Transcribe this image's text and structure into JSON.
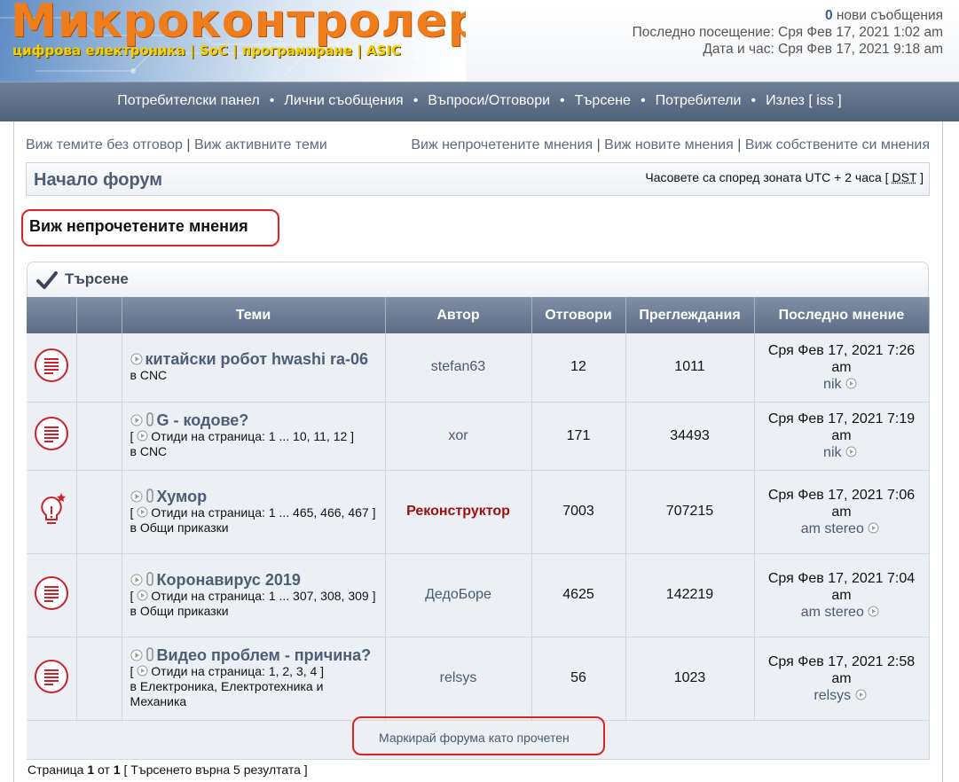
{
  "header": {
    "logo_title": "Микроконтролери",
    "logo_subtitle": "цифрова електроника | SoC | програмиране | ASIC",
    "new_messages_count": "0",
    "new_messages_label": " нови съобщения",
    "last_visit": "Последно посещение: Сря Фев 17, 2021 1:02 am",
    "current_time": "Дата и час: Сря Фев 17, 2021 9:18 am"
  },
  "navbar": {
    "items": [
      "Потребителски панел",
      "Лични съобщения",
      "Въпроси/Отговори",
      "Търсене",
      "Потребители",
      "Излез [ iss ]"
    ]
  },
  "quick_links": {
    "left": [
      "Виж темите без отговор",
      "Виж активните теми"
    ],
    "right": [
      "Виж непрочетените мнения",
      "Виж новите мнения",
      "Виж собствените си мнения"
    ]
  },
  "breadcrumb": {
    "title": "Начало форум"
  },
  "timezone": {
    "prefix": "Часовете са според зоната UTC + 2 часа [ ",
    "dst": "DST",
    "suffix": " ]"
  },
  "page_heading": "Виж непрочетените мнения",
  "panel": {
    "title": "Търсене"
  },
  "table": {
    "headers": {
      "topics": "Теми",
      "author": "Автор",
      "replies": "Отговори",
      "views": "Преглеждания",
      "last_post": "Последно мнение"
    },
    "rows": [
      {
        "title": "китайски робот hwashi ra-06",
        "pages_prefix": "",
        "pages": "",
        "forum_prefix": "в ",
        "forum": "CNC",
        "author": "stefan63",
        "replies": "12",
        "views": "1011",
        "last_date": "Сря Фев 17, 2021 7:26",
        "last_ampm": "am",
        "last_by": "nik"
      },
      {
        "title": "G - кодове?",
        "pages_prefix": "Отиди на страница: ",
        "pages": "1 ... 10, 11, 12",
        "forum_prefix": "в ",
        "forum": "CNC",
        "author": "xor",
        "replies": "171",
        "views": "34493",
        "last_date": "Сря Фев 17, 2021 7:19",
        "last_ampm": "am",
        "last_by": "nik"
      },
      {
        "title": "Хумор",
        "pages_prefix": "Отиди на страница: ",
        "pages": "1 ... 465, 466, 467",
        "forum_prefix": "в ",
        "forum": "Общи приказки",
        "author": "Реконструктор",
        "replies": "7003",
        "views": "707215",
        "last_date": "Сря Фев 17, 2021 7:06",
        "last_ampm": "am",
        "last_by": "am stereo"
      },
      {
        "title": "Коронавирус 2019",
        "pages_prefix": "Отиди на страница: ",
        "pages": "1 ... 307, 308, 309",
        "forum_prefix": "в ",
        "forum": "Общи приказки",
        "author": "ДедоБоре",
        "replies": "4625",
        "views": "142219",
        "last_date": "Сря Фев 17, 2021 7:04",
        "last_ampm": "am",
        "last_by": "am stereo"
      },
      {
        "title": "Видео проблем - причина?",
        "pages_prefix": "Отиди на страница: ",
        "pages": "1, 2, 3, 4",
        "forum_prefix": "в ",
        "forum": "Електроника, Електротехника и Механика",
        "author": "relsys",
        "replies": "56",
        "views": "1023",
        "last_date": "Сря Фев 17, 2021 2:58",
        "last_ampm": "am",
        "last_by": "relsys"
      }
    ]
  },
  "mark_read": "Маркирай форума като прочетен",
  "pagination": {
    "p1": "Страница ",
    "cur": "1",
    "p2": " от ",
    "total": "1",
    "p3": " [ Търсенето върна 5 резултата ]"
  },
  "colors": {
    "accent_red": "#dd2222",
    "link": "#4a5a72",
    "header_blue": "#5d6d86",
    "special_author": "#a01010"
  },
  "icons": {
    "topic_icon": "topic-list-icon",
    "hot_icon": "bulb-star-icon",
    "goto_icon": "play-circle-icon",
    "attach_icon": "paperclip-icon",
    "check_icon": "checkmark-icon"
  }
}
